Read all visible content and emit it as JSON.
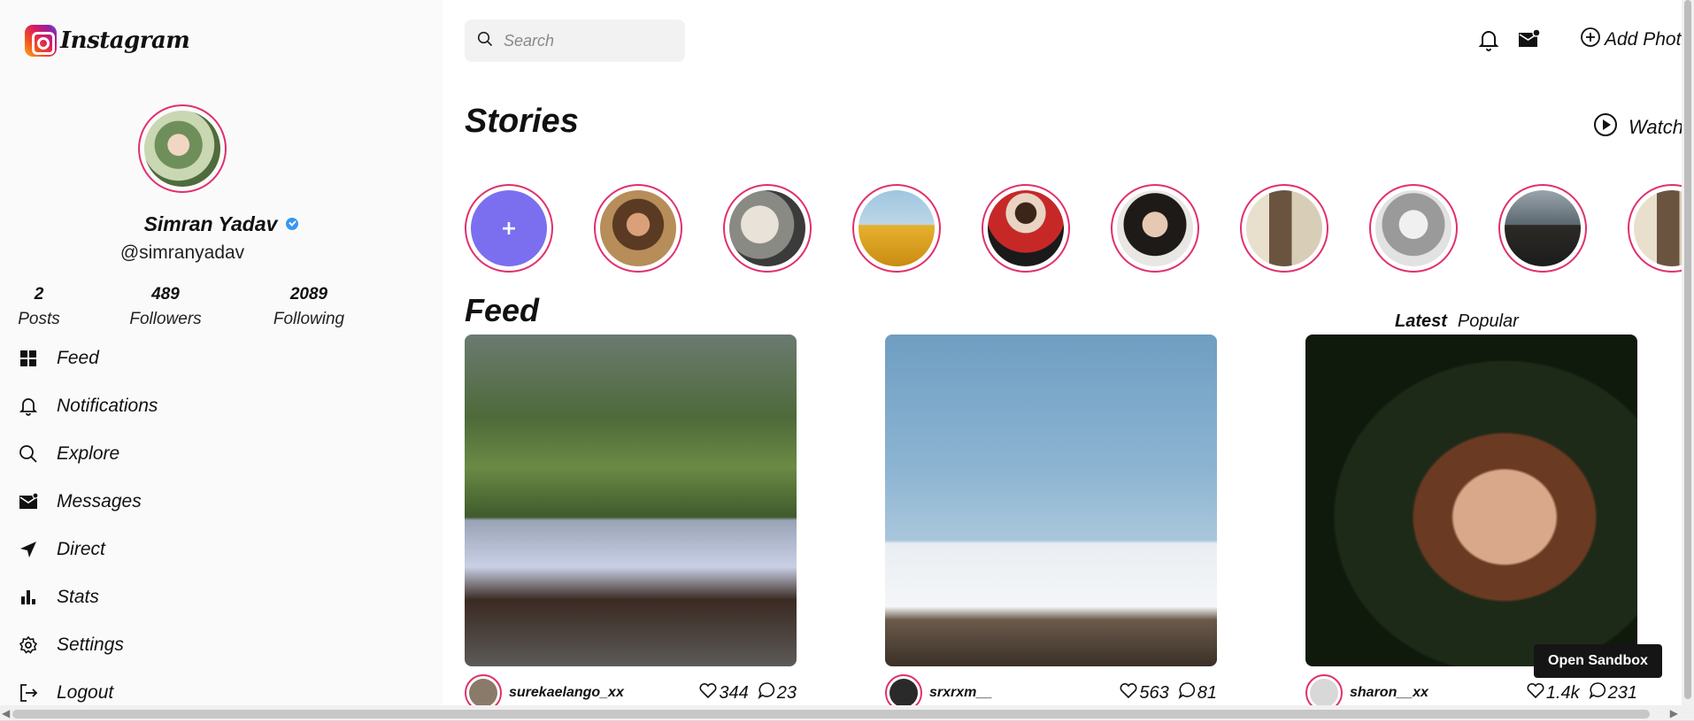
{
  "app": {
    "logo_text": "Instagram"
  },
  "profile": {
    "name": "Simran Yadav",
    "handle": "@simranyadav",
    "verified": true
  },
  "stats": [
    {
      "value": "2",
      "label": "Posts"
    },
    {
      "value": "489",
      "label": "Followers"
    },
    {
      "value": "2089",
      "label": "Following"
    }
  ],
  "nav": [
    {
      "label": "Feed",
      "icon": "grid-icon"
    },
    {
      "label": "Notifications",
      "icon": "bell-icon"
    },
    {
      "label": "Explore",
      "icon": "search-icon"
    },
    {
      "label": "Messages",
      "icon": "mail-icon"
    },
    {
      "label": "Direct",
      "icon": "send-icon"
    },
    {
      "label": "Stats",
      "icon": "bar-chart-icon"
    },
    {
      "label": "Settings",
      "icon": "gear-icon"
    },
    {
      "label": "Logout",
      "icon": "logout-icon"
    }
  ],
  "search": {
    "placeholder": "Search"
  },
  "header": {
    "add_photo_label": "Add Photo"
  },
  "stories": {
    "title": "Stories",
    "watch_label": "Watch all",
    "add_symbol": "+"
  },
  "feed": {
    "title": "Feed",
    "tabs": [
      "Latest",
      "Popular"
    ],
    "posts": [
      {
        "username": "surekaelango_xx",
        "likes": "344",
        "comments": "23"
      },
      {
        "username": "srxrxm__",
        "likes": "563",
        "comments": "81"
      },
      {
        "username": "sharon__xx",
        "likes": "1.4k",
        "comments": "231"
      }
    ]
  },
  "sandbox_button": "Open Sandbox",
  "colors": {
    "accent_ring": "#e1306c",
    "verified_blue": "#3897f0",
    "add_story_bg": "#7b6ff0"
  }
}
